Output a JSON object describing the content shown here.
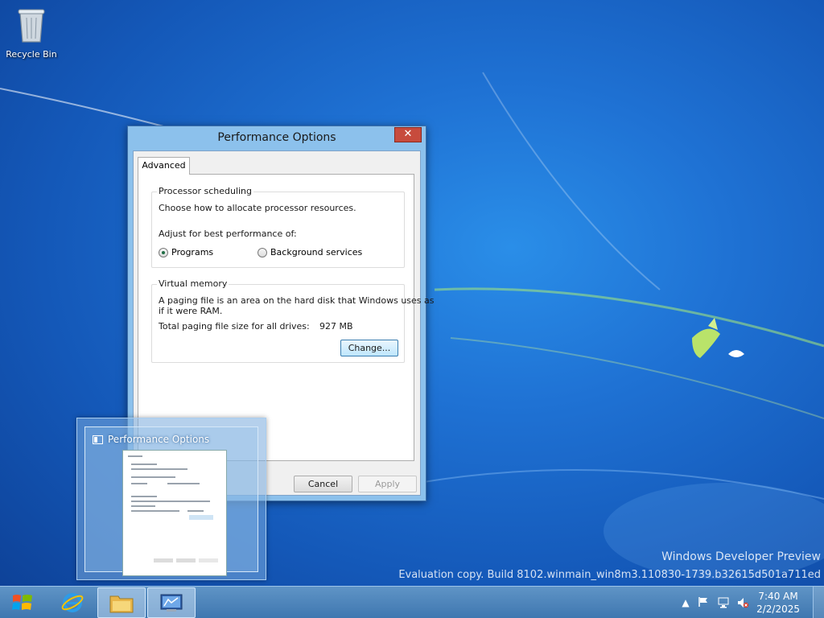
{
  "desktop": {
    "icons": [
      {
        "label": "Recycle Bin",
        "icon": "recycle-bin-icon"
      }
    ],
    "watermark": {
      "line1": "Windows Developer Preview",
      "line2": "Evaluation copy. Build 8102.winmain_win8m3.110830-1739.b32615d501a711ed"
    }
  },
  "dialog": {
    "title": "Performance Options",
    "close_label": "✕",
    "tabs": [
      "Advanced"
    ],
    "processor": {
      "legend": "Processor scheduling",
      "description": "Choose how to allocate processor resources.",
      "adjust_label": "Adjust for best performance of:",
      "options": [
        {
          "label": "Programs",
          "selected": true
        },
        {
          "label": "Background services",
          "selected": false
        }
      ]
    },
    "memory": {
      "legend": "Virtual memory",
      "description_line1": "A paging file is an area on the hard disk that Windows uses as",
      "description_line2": "if it were RAM.",
      "total_label": "Total paging file size for all drives:",
      "total_value": "927 MB",
      "change_button": "Change..."
    },
    "buttons": {
      "cancel": "Cancel",
      "apply": "Apply"
    }
  },
  "thumbnail": {
    "title": "Performance Options"
  },
  "taskbar": {
    "pinned": [
      "internet-explorer-icon",
      "file-explorer-icon",
      "performance-options-icon"
    ],
    "clock": {
      "time": "7:40 AM",
      "date": "2/2/2025"
    },
    "tray_icons": [
      "show-hidden-icons-icon",
      "action-center-flag-icon",
      "network-icon",
      "volume-muted-icon"
    ]
  },
  "colors": {
    "desktop_bg": "#1f72d4",
    "dialog_frame": "#8cc1ec",
    "close_button": "#c74b3d",
    "taskbar": "#4a80b8"
  }
}
